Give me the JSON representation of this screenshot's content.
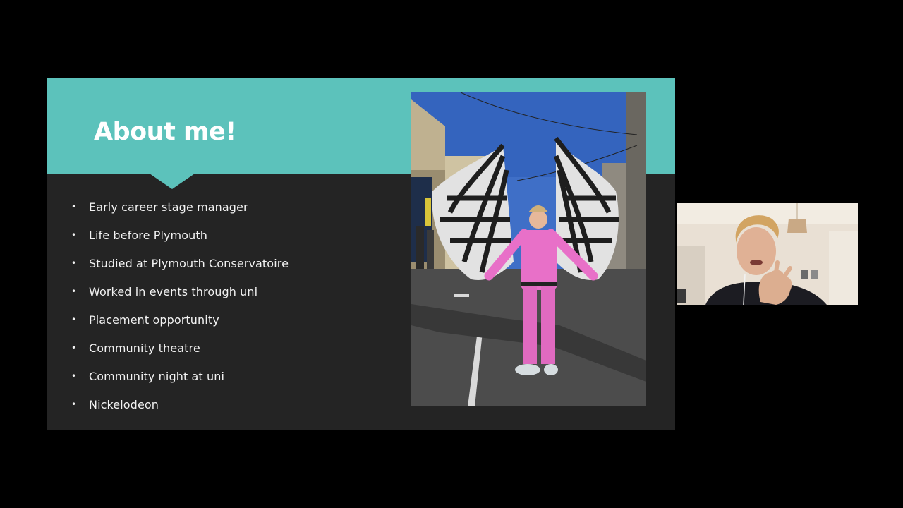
{
  "slide": {
    "title": "About me!",
    "bullet_glyph": "•",
    "bullets": [
      "Early career stage manager",
      "Life before Plymouth",
      "Studied at Plymouth Conservatoire",
      "Worked in events through uni",
      "Placement opportunity",
      "Community theatre",
      "Community night at uni",
      "Nickelodeon"
    ],
    "accent_color": "#5cc2bb",
    "background_color": "#242424"
  },
  "photo": {
    "description_icon": "photo-person-in-pink-jumpsuit-with-zebra-wings"
  },
  "webcam": {
    "icon": "participant-video-feed"
  }
}
